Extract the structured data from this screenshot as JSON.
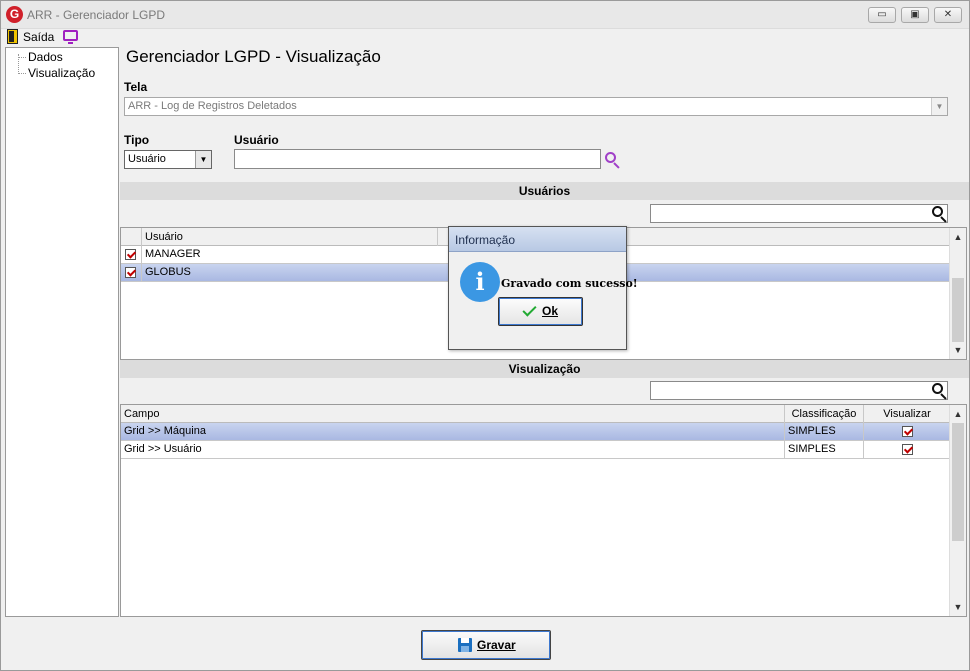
{
  "window": {
    "title": "ARR - Gerenciador LGPD",
    "app_icon_letter": "G",
    "controls": {
      "minimize": "▭",
      "restore": "▣",
      "close": "✕"
    }
  },
  "menu": {
    "saida_label": "Saída"
  },
  "tree": {
    "items": [
      "Dados",
      "Visualização"
    ]
  },
  "page_title": "Gerenciador LGPD - Visualização",
  "form": {
    "tela_label": "Tela",
    "tela_value": "ARR - Log de Registros Deletados",
    "tipo_label": "Tipo",
    "tipo_value": "Usuário",
    "usuario_label": "Usuário",
    "usuario_value": ""
  },
  "usuarios_section": {
    "title": "Usuários",
    "columns": [
      "Usuário"
    ],
    "rows": [
      {
        "checked": true,
        "name": "MANAGER",
        "selected": false
      },
      {
        "checked": true,
        "name": "GLOBUS",
        "selected": true
      }
    ]
  },
  "visualizacao_section": {
    "title": "Visualização",
    "columns": [
      "Campo",
      "Classificação",
      "Visualizar"
    ],
    "rows": [
      {
        "campo": "Grid >> Máquina",
        "classificacao": "SIMPLES",
        "visualizar": true,
        "selected": true
      },
      {
        "campo": "Grid >> Usuário",
        "classificacao": "SIMPLES",
        "visualizar": true,
        "selected": false
      }
    ]
  },
  "dialog": {
    "title": "Informação",
    "icon_letter": "i",
    "message": "Gravado com sucesso!",
    "ok_label": "Ok"
  },
  "footer": {
    "gravar_label": "Gravar"
  },
  "colors": {
    "accent_selection": "#b4c2e8",
    "purple_icon": "#a020c0",
    "info_blue": "#3b97e3",
    "check_red": "#c00000"
  }
}
